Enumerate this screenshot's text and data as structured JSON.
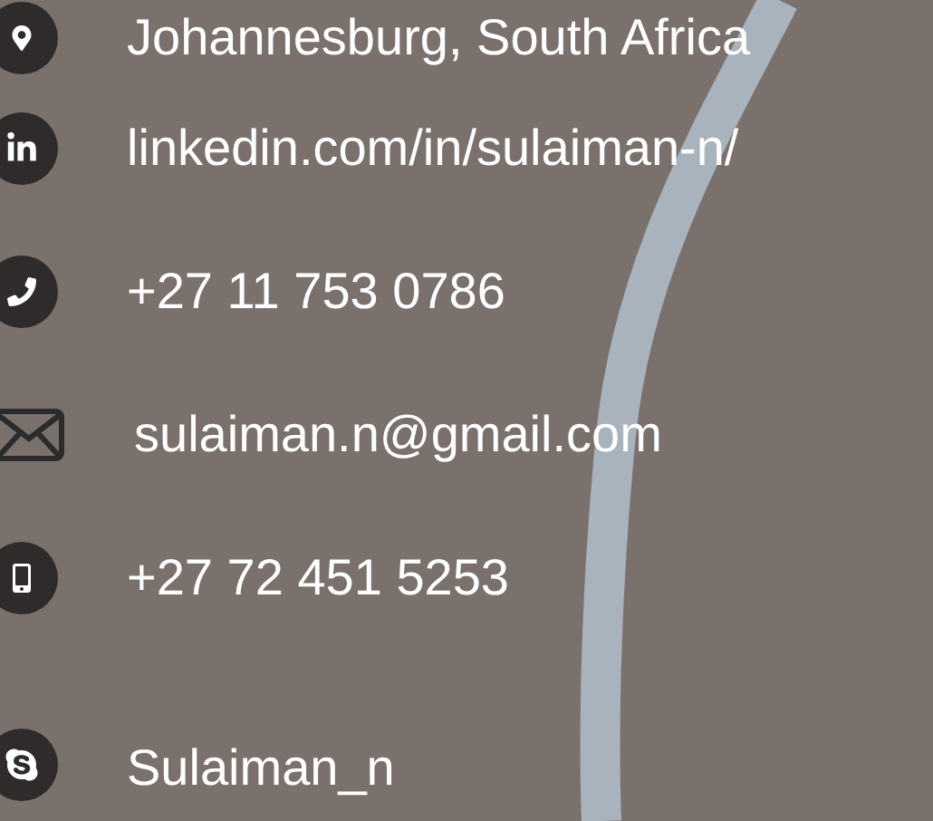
{
  "contacts": [
    {
      "kind": "location",
      "text": "Johannesburg, South Africa"
    },
    {
      "kind": "linkedin",
      "text": "linkedin.com/in/sulaiman-n/"
    },
    {
      "kind": "phone",
      "text": "+27 11 753 0786"
    },
    {
      "kind": "email",
      "text": "sulaiman.n@gmail.com"
    },
    {
      "kind": "mobile",
      "text": "+27 72 451 5253"
    },
    {
      "kind": "skype",
      "text": "Sulaiman_n"
    }
  ]
}
